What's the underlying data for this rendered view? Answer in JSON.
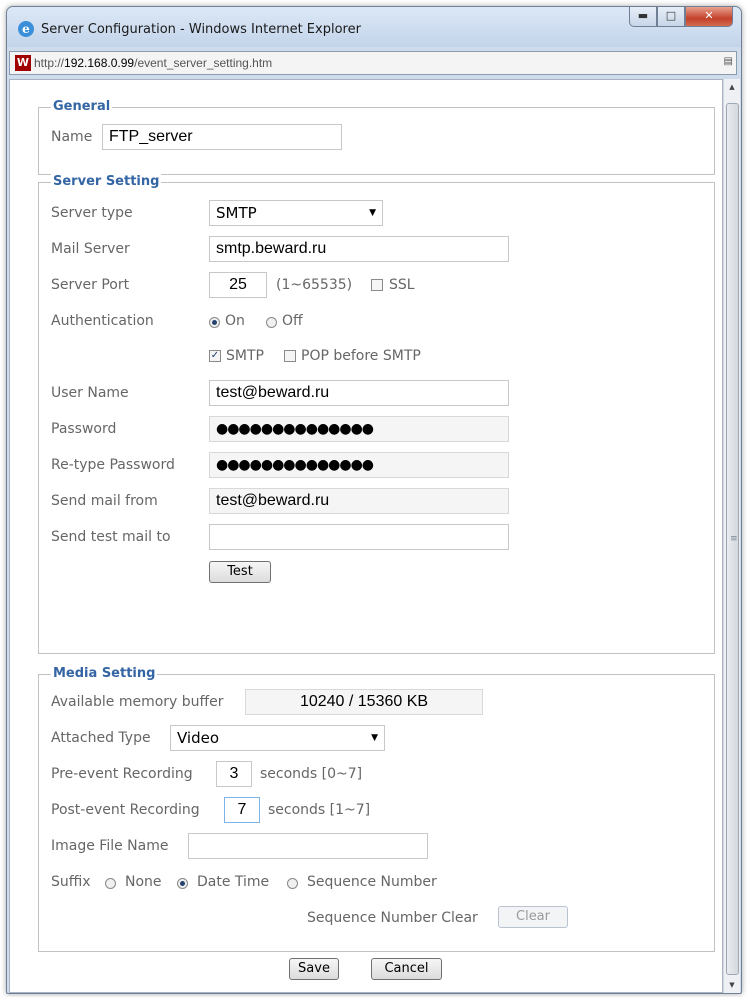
{
  "window": {
    "title": "Server Configuration - Windows Internet Explorer",
    "url_prefix": "http://",
    "url_host": "192.168.0.99",
    "url_path": "/event_server_setting.htm"
  },
  "general": {
    "legend": "General",
    "name_label": "Name",
    "name_value": "FTP_server"
  },
  "server": {
    "legend": "Server Setting",
    "type_label": "Server type",
    "type_value": "SMTP",
    "mail_label": "Mail Server",
    "mail_value": "smtp.beward.ru",
    "port_label": "Server Port",
    "port_value": "25",
    "port_range": "(1~65535)",
    "ssl_label": "SSL",
    "auth_label": "Authentication",
    "auth_on": "On",
    "auth_off": "Off",
    "smtp_label": "SMTP",
    "pop_label": "POP before SMTP",
    "user_label": "User Name",
    "user_value": "test@beward.ru",
    "pass_label": "Password",
    "pass_value": "●●●●●●●●●●●●●●",
    "repass_label": "Re-type Password",
    "repass_value": "●●●●●●●●●●●●●●",
    "from_label": "Send mail from",
    "from_value": "test@beward.ru",
    "test_to_label": "Send test mail to",
    "test_to_value": "",
    "test_button": "Test"
  },
  "media": {
    "legend": "Media Setting",
    "buffer_label": "Available memory buffer",
    "buffer_value": "10240 / 15360 KB",
    "attached_label": "Attached Type",
    "attached_value": "Video",
    "pre_label": "Pre-event Recording",
    "pre_value": "3",
    "pre_unit": "seconds [0~7]",
    "post_label": "Post-event Recording",
    "post_value": "7",
    "post_unit": "seconds [1~7]",
    "image_label": "Image File Name",
    "image_value": "",
    "suffix_label": "Suffix",
    "suffix_none": "None",
    "suffix_date": "Date Time",
    "suffix_seq": "Sequence Number",
    "seq_clear_label": "Sequence Number Clear",
    "clear_button": "Clear"
  },
  "footer": {
    "save": "Save",
    "cancel": "Cancel"
  },
  "colors": {
    "legend": "#3465a4",
    "label": "#666666"
  }
}
